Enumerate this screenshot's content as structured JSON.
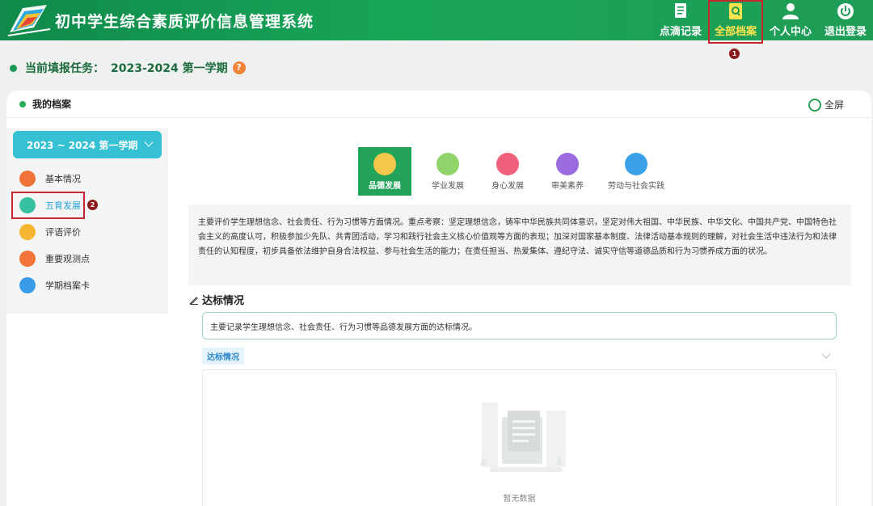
{
  "app": {
    "title": "初中学生综合素质评价信息管理系统"
  },
  "nav": [
    {
      "label": "点滴记录",
      "icon": "notes-icon"
    },
    {
      "label": "全部档案",
      "icon": "archive-icon",
      "active": true,
      "marker": "1"
    },
    {
      "label": "个人中心",
      "icon": "user-icon"
    },
    {
      "label": "退出登录",
      "icon": "power-icon"
    }
  ],
  "task": {
    "label": "当前填报任务：",
    "value": "2023-2024 第一学期",
    "help": "?"
  },
  "panel": {
    "title": "我的档案",
    "fullscreen": "全屏"
  },
  "sidebar": {
    "term": "2023 ~ 2024 第一学期",
    "items": [
      {
        "label": "基本情况",
        "icon": "profile-icon",
        "color": "#f0733a"
      },
      {
        "label": "五育发展",
        "icon": "five-education-icon",
        "color": "#35c1a0",
        "active": true,
        "marker": "2"
      },
      {
        "label": "评语评价",
        "icon": "comment-icon",
        "color": "#f5b731"
      },
      {
        "label": "重要观测点",
        "icon": "target-icon",
        "color": "#f0733a"
      },
      {
        "label": "学期档案卡",
        "icon": "card-icon",
        "color": "#3a9be8"
      }
    ]
  },
  "tabs": [
    {
      "label": "品德发展",
      "icon": "morality-icon",
      "active": true
    },
    {
      "label": "学业发展",
      "icon": "academic-icon",
      "color": "#8fd46a"
    },
    {
      "label": "身心发展",
      "icon": "health-icon",
      "color": "#f0607a"
    },
    {
      "label": "审美素养",
      "icon": "art-icon",
      "color": "#9b6be0"
    },
    {
      "label": "劳动与社会实践",
      "icon": "labor-icon",
      "color": "#3aa0e8"
    }
  ],
  "description": "主要评价学生理想信念、社会责任、行为习惯等方面情况。重点考察：坚定理想信念，铸牢中华民族共同体意识，坚定对伟大祖国、中华民族、中华文化、中国共产党、中国特色社会主义的高度认可，积极参加少先队、共青团活动，学习和践行社会主义核心价值观等方面的表现；加深对国家基本制度、法律活动基本规则的理解，对社会生活中违法行为和法律责任的认知程度，初步具备依法维护自身合法权益、参与社会生活的能力；在责任担当、热爱集体、遵纪守法、诚实守信等道德品质和行为习惯养成方面的状况。",
  "section": {
    "title": "达标情况",
    "note": "主要记录学生理想信念、社会责任、行为习惯等品德发展方面的达标情况。",
    "tag": "达标情况",
    "empty": "暂无数据"
  }
}
